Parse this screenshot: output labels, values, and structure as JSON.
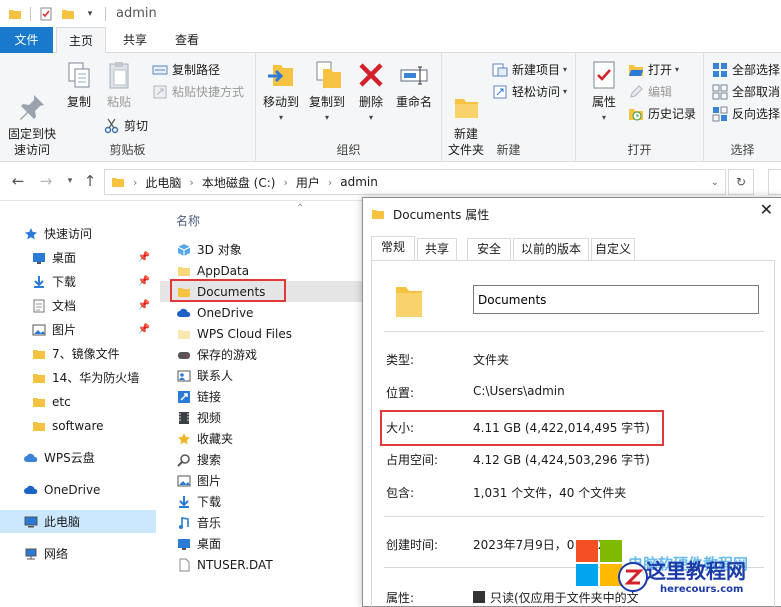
{
  "window": {
    "title": "admin"
  },
  "ribbon_tabs": {
    "file": "文件",
    "home": "主页",
    "share": "共享",
    "view": "查看"
  },
  "ribbon": {
    "clipboard": {
      "label": "剪贴板",
      "pin_quick_access": "固定到快\n速访问",
      "copy": "复制",
      "paste": "粘贴",
      "copy_path": "复制路径",
      "paste_shortcut": "粘贴快捷方式",
      "cut": "剪切"
    },
    "organize": {
      "label": "组织",
      "move_to": "移动到",
      "copy_to": "复制到",
      "delete": "删除",
      "rename": "重命名"
    },
    "new": {
      "label": "新建",
      "new_folder": "新建\n文件夹",
      "new_item": "新建项目",
      "easy_access": "轻松访问"
    },
    "open": {
      "label": "打开",
      "properties": "属性",
      "open": "打开",
      "edit": "编辑",
      "history": "历史记录"
    },
    "select": {
      "label": "选择",
      "select_all": "全部选择",
      "select_none": "全部取消",
      "invert": "反向选择"
    }
  },
  "address": {
    "crumbs": [
      "此电脑",
      "本地磁盘 (C:)",
      "用户",
      "admin"
    ]
  },
  "nav": {
    "items": [
      {
        "label": "快速访问",
        "icon": "star-icon"
      },
      {
        "label": "桌面",
        "icon": "desktop-icon"
      },
      {
        "label": "下载",
        "icon": "download-icon"
      },
      {
        "label": "文档",
        "icon": "document-icon"
      },
      {
        "label": "图片",
        "icon": "picture-icon"
      },
      {
        "label": "7、镜像文件",
        "icon": "folder-icon"
      },
      {
        "label": "14、华为防火墙",
        "icon": "folder-icon"
      },
      {
        "label": "etc",
        "icon": "folder-icon"
      },
      {
        "label": "software",
        "icon": "folder-icon"
      },
      {
        "label": "WPS云盘",
        "icon": "cloud-icon"
      },
      {
        "label": "OneDrive",
        "icon": "cloud-icon"
      },
      {
        "label": "此电脑",
        "icon": "computer-icon"
      },
      {
        "label": "网络",
        "icon": "network-icon"
      }
    ]
  },
  "filelist": {
    "column_name": "名称",
    "files": [
      {
        "name": "3D 对象",
        "icon": "3d-objects-icon"
      },
      {
        "name": "AppData",
        "icon": "folder-icon"
      },
      {
        "name": "Documents",
        "icon": "folder-icon"
      },
      {
        "name": "OneDrive",
        "icon": "cloud-icon"
      },
      {
        "name": "WPS Cloud Files",
        "icon": "folder-icon"
      },
      {
        "name": "保存的游戏",
        "icon": "saved-games-icon"
      },
      {
        "name": "联系人",
        "icon": "contacts-icon"
      },
      {
        "name": "链接",
        "icon": "links-icon"
      },
      {
        "name": "视频",
        "icon": "video-icon"
      },
      {
        "name": "收藏夹",
        "icon": "favorites-icon"
      },
      {
        "name": "搜索",
        "icon": "search-icon"
      },
      {
        "name": "图片",
        "icon": "picture-icon"
      },
      {
        "name": "下载",
        "icon": "download-icon"
      },
      {
        "name": "音乐",
        "icon": "music-icon"
      },
      {
        "name": "桌面",
        "icon": "desktop-icon"
      },
      {
        "name": "NTUSER.DAT",
        "icon": "file-icon"
      }
    ]
  },
  "dialog": {
    "title": "Documents 属性",
    "tabs": [
      "常规",
      "共享",
      "安全",
      "以前的版本",
      "自定义"
    ],
    "name_value": "Documents",
    "rows": [
      {
        "label": "类型:",
        "value": "文件夹"
      },
      {
        "label": "位置:",
        "value": "C:\\Users\\admin"
      },
      {
        "label": "大小:",
        "value": "4.11 GB (4,422,014,495 字节)"
      },
      {
        "label": "占用空间:",
        "value": "4.12 GB (4,424,503,296 字节)"
      },
      {
        "label": "包含:",
        "value": "1,031 个文件，40 个文件夹"
      },
      {
        "label": "创建时间:",
        "value": "2023年7月9日，0:14:24"
      },
      {
        "label": "属性:",
        "value": "只读(仅应用于文件夹中的文"
      }
    ]
  },
  "watermark": {
    "text": "这里教程网",
    "url": "herecours.com",
    "blurred": "电脑软硬件教程网"
  },
  "colors": {
    "accent": "#1979ca",
    "selection": "#cce8ff",
    "highlight_box": "#e0383b",
    "folder": "#f5c242"
  }
}
